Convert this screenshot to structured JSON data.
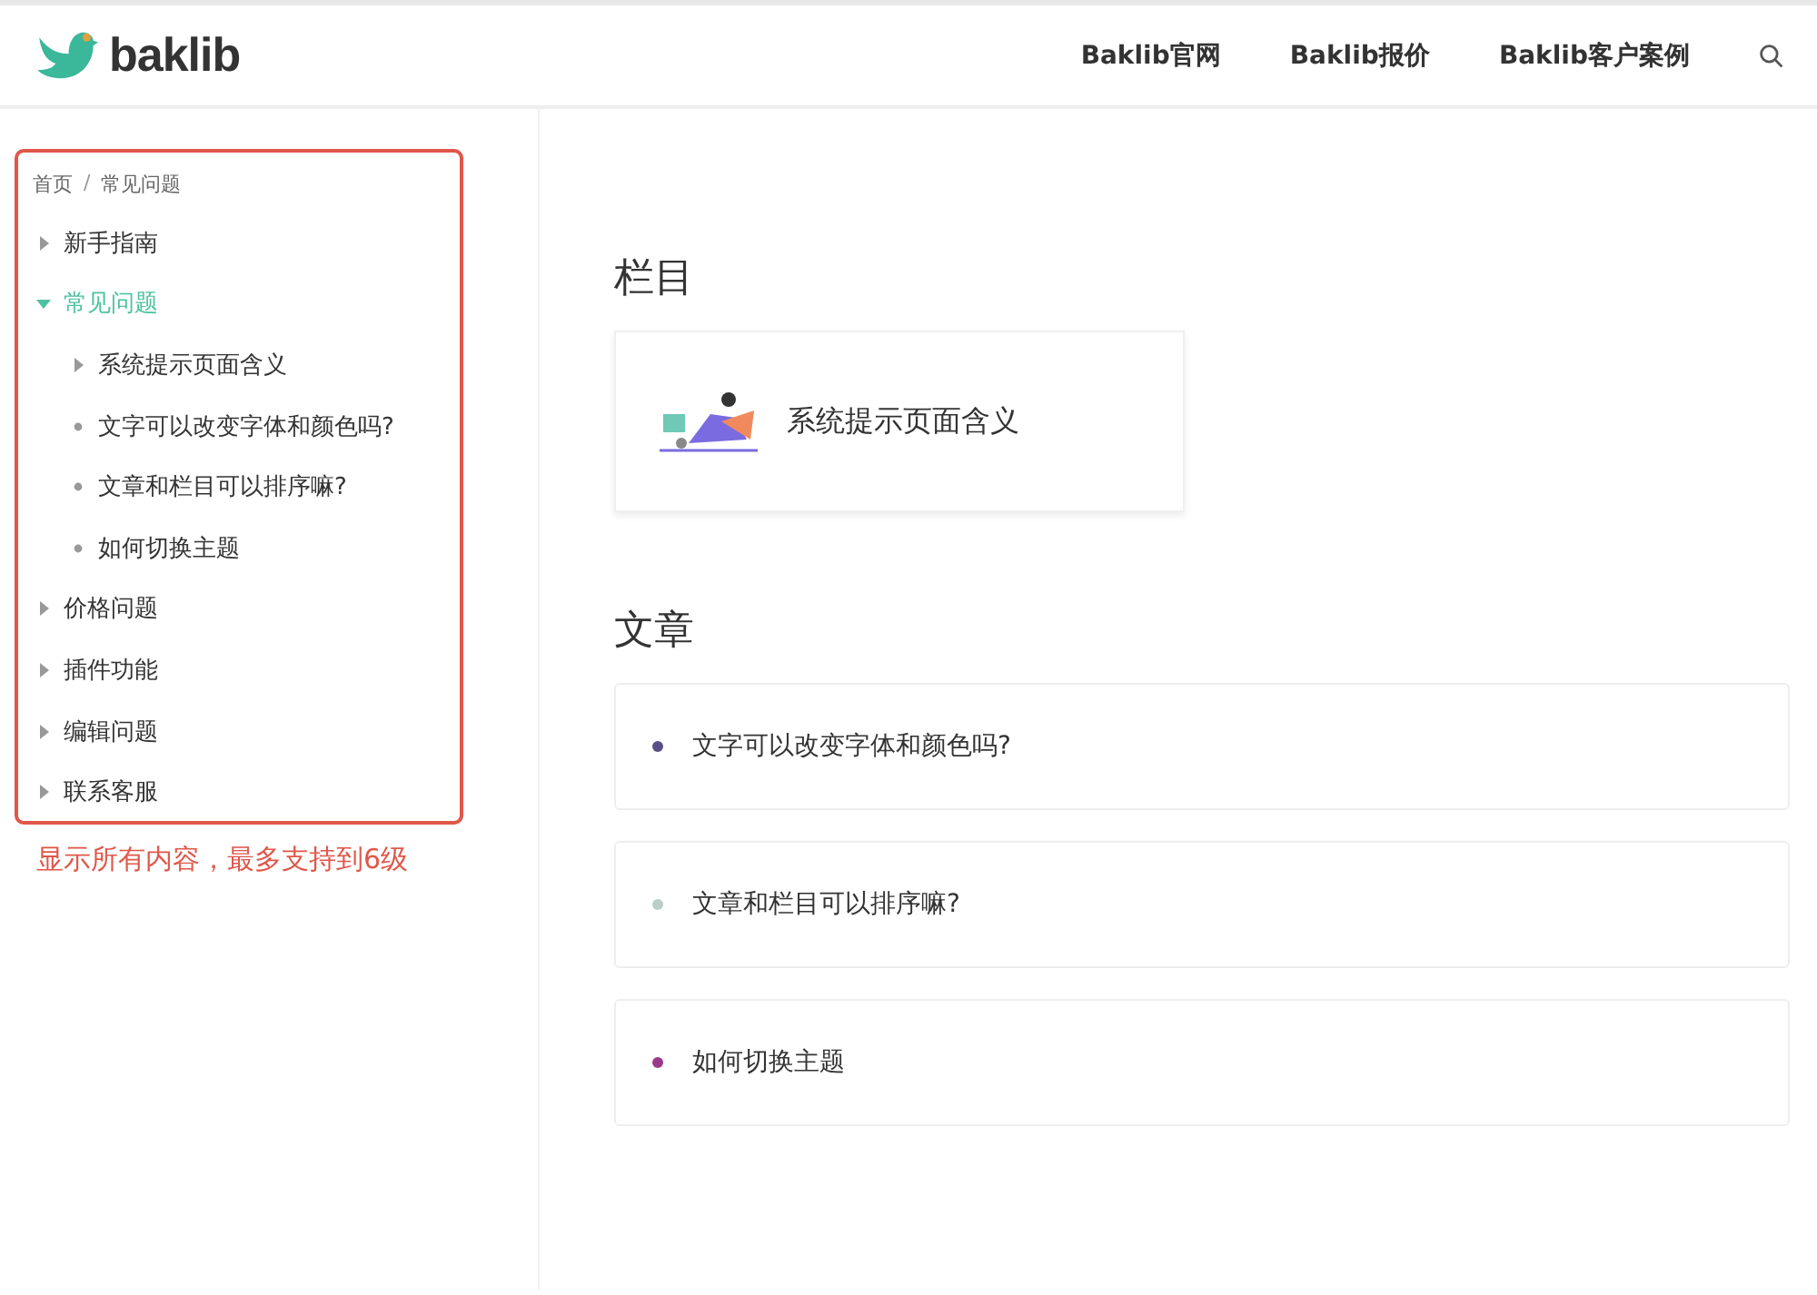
{
  "header": {
    "logo_text": "baklib",
    "nav": [
      {
        "label": "Baklib官网"
      },
      {
        "label": "Baklib报价"
      },
      {
        "label": "Baklib客户案例"
      }
    ]
  },
  "breadcrumb": {
    "items": [
      "首页",
      "常见问题"
    ],
    "separator": "/"
  },
  "tree": [
    {
      "label": "新手指南",
      "kind": "branch",
      "expanded": false,
      "selected": false
    },
    {
      "label": "常见问题",
      "kind": "branch",
      "expanded": true,
      "selected": true,
      "children": [
        {
          "label": "系统提示页面含义",
          "kind": "branch",
          "expanded": false,
          "selected": false
        },
        {
          "label": "文字可以改变字体和颜色吗?",
          "kind": "leaf",
          "selected": false
        },
        {
          "label": "文章和栏目可以排序嘛?",
          "kind": "leaf",
          "selected": false
        },
        {
          "label": "如何切换主题",
          "kind": "leaf",
          "selected": false
        }
      ]
    },
    {
      "label": "价格问题",
      "kind": "branch",
      "expanded": false,
      "selected": false
    },
    {
      "label": "插件功能",
      "kind": "branch",
      "expanded": false,
      "selected": false
    },
    {
      "label": "编辑问题",
      "kind": "branch",
      "expanded": false,
      "selected": false
    },
    {
      "label": "联系客服",
      "kind": "branch",
      "expanded": false,
      "selected": false
    }
  ],
  "annotation": "显示所有内容，最多支持到6级",
  "columns_section": {
    "title": "栏目",
    "cards": [
      {
        "label": "系统提示页面含义"
      }
    ]
  },
  "articles_section": {
    "title": "文章",
    "items": [
      {
        "label": "文字可以改变字体和颜色吗?",
        "color": "#5a4e8a"
      },
      {
        "label": "文章和栏目可以排序嘛?",
        "color": "#b9cfc9"
      },
      {
        "label": "如何切换主题",
        "color": "#9b3a8a"
      }
    ]
  }
}
